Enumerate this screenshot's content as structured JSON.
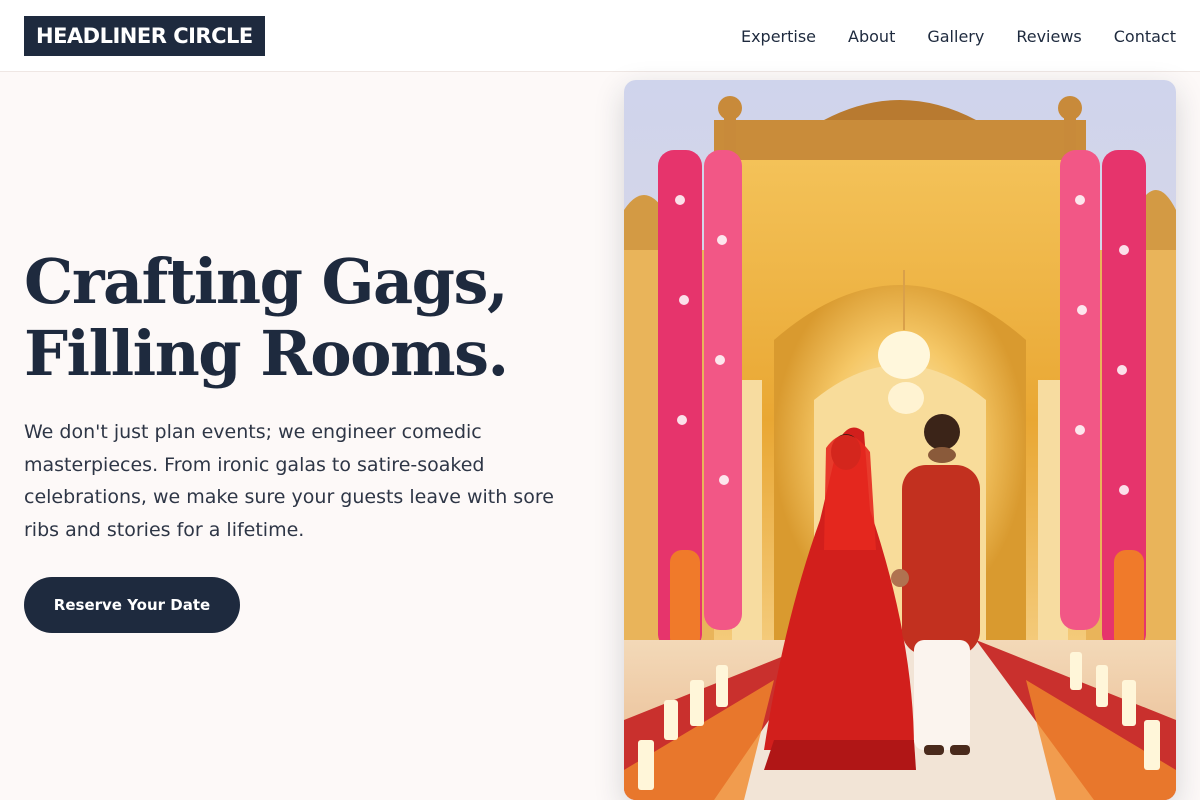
{
  "header": {
    "logo_text": "HEADLINER CIRCLE",
    "nav": [
      "Expertise",
      "About",
      "Gallery",
      "Reviews",
      "Contact"
    ]
  },
  "hero": {
    "title_line_1": "Crafting Gags,",
    "title_line_2": "Filling Rooms.",
    "description": "We don't just plan events; we engineer comedic masterpieces. From ironic galas to satire-soaked celebrations, we make sure your guests leave with sore ribs and stories for a lifetime.",
    "cta_label": "Reserve Your Date"
  },
  "colors": {
    "navy": "#1e2a3e",
    "background": "#fdf9f8",
    "white": "#ffffff"
  }
}
